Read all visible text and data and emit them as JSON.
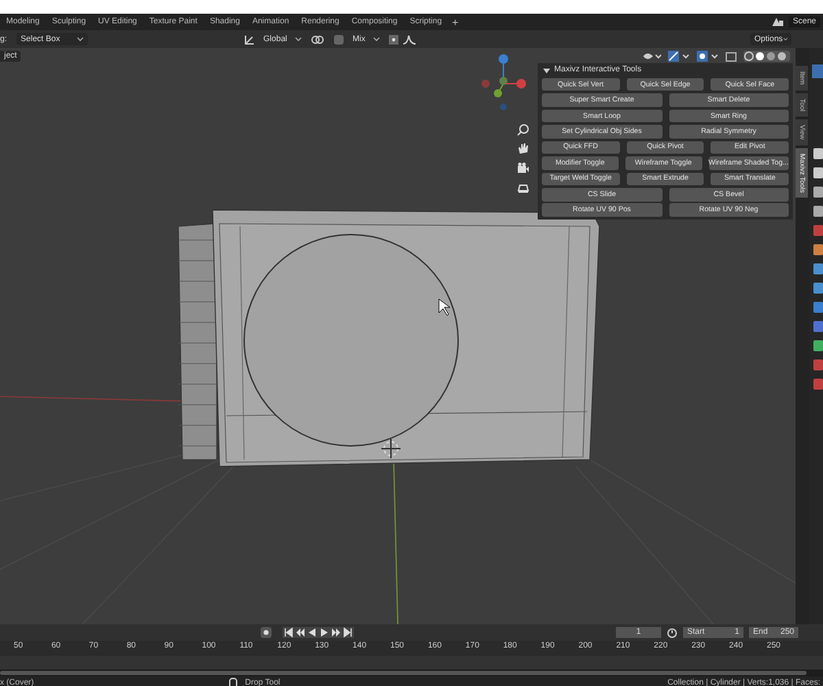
{
  "workspace_tabs": [
    {
      "label": "Modeling",
      "selected": false
    },
    {
      "label": "Sculpting",
      "selected": false
    },
    {
      "label": "UV Editing",
      "selected": false
    },
    {
      "label": "Texture Paint",
      "selected": false
    },
    {
      "label": "Shading",
      "selected": false
    },
    {
      "label": "Animation",
      "selected": false
    },
    {
      "label": "Rendering",
      "selected": false
    },
    {
      "label": "Compositing",
      "selected": false
    },
    {
      "label": "Scripting",
      "selected": false
    }
  ],
  "add_tab": "+",
  "scene": "Scene",
  "header": {
    "drag_label": "g:",
    "select_mode": "Select Box",
    "orientation": "Global",
    "snap_mode": "Mix",
    "options": "Options"
  },
  "viewport": {
    "mode": "ject",
    "panel": {
      "title": "Maxivz Interactive Tools",
      "expanded": true,
      "rows": [
        [
          "Quick Sel Vert",
          "Quick Sel Edge",
          "Quick Sel Face"
        ],
        [
          "Super Smart Create",
          "Smart Delete"
        ],
        [
          "Smart Loop",
          "Smart Ring"
        ],
        [
          "Set Cylindrical Obj Sides",
          "Radial Symmetry"
        ],
        [
          "Quick FFD",
          "Quick Pivot",
          "Edit Pivot"
        ],
        [
          "Modifier Toggle",
          "Wireframe Toggle",
          "Wireframe Shaded Tog..."
        ],
        [
          "Target Weld Toggle",
          "Smart Extrude",
          "Smart Translate"
        ],
        [
          "CS Slide",
          "CS Bevel"
        ],
        [
          "Rotate UV 90 Pos",
          "Rotate UV 90 Neg"
        ]
      ]
    },
    "sidebar_tabs": [
      {
        "label": "Item",
        "selected": false
      },
      {
        "label": "Tool",
        "selected": false
      },
      {
        "label": "View",
        "selected": false
      },
      {
        "label": "Maxivz Tools",
        "selected": true
      }
    ]
  },
  "timeline": {
    "current_frame": "1",
    "start_label": "Start",
    "start": "1",
    "end_label": "End",
    "end": "250",
    "ruler": [
      "50",
      "60",
      "70",
      "80",
      "90",
      "100",
      "110",
      "120",
      "130",
      "140",
      "150",
      "160",
      "170",
      "180",
      "190",
      "200",
      "210",
      "220",
      "230",
      "240",
      "250"
    ]
  },
  "status_bar": {
    "left": "x (Cover)",
    "tool": "Drop Tool",
    "stats": "Collection | Cylinder | Verts:1,036 | Faces:"
  }
}
